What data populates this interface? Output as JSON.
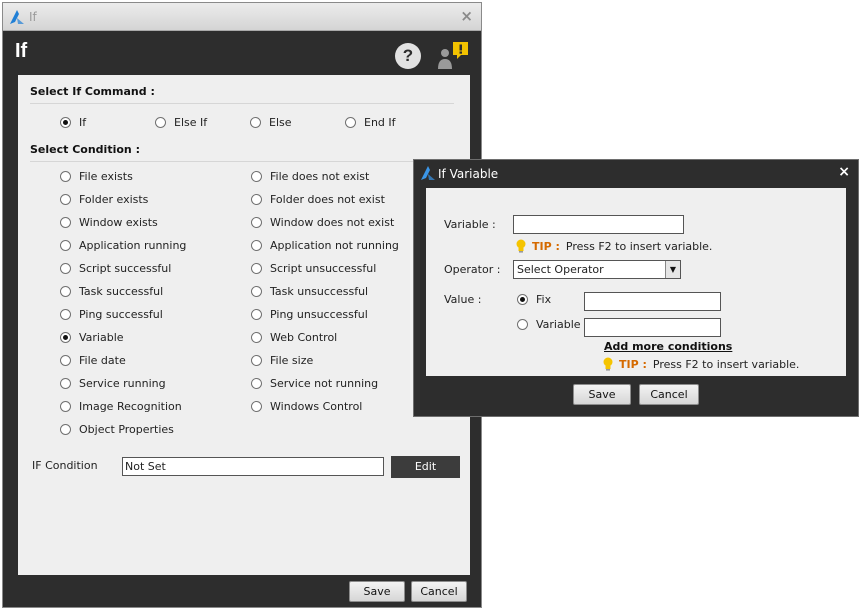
{
  "main_window": {
    "title": "If",
    "close_glyph": "×",
    "header_title": "If",
    "help_glyph": "?",
    "select_command_label": "Select If Command :",
    "commands": [
      {
        "label": "If",
        "checked": true
      },
      {
        "label": "Else If",
        "checked": false
      },
      {
        "label": "Else",
        "checked": false
      },
      {
        "label": "End If",
        "checked": false
      }
    ],
    "select_condition_label": "Select Condition :",
    "conditions_left": [
      {
        "label": "File exists",
        "checked": false
      },
      {
        "label": "Folder exists",
        "checked": false
      },
      {
        "label": "Window exists",
        "checked": false
      },
      {
        "label": "Application running",
        "checked": false
      },
      {
        "label": "Script successful",
        "checked": false
      },
      {
        "label": "Task successful",
        "checked": false
      },
      {
        "label": "Ping successful",
        "checked": false
      },
      {
        "label": "Variable",
        "checked": true
      },
      {
        "label": "File date",
        "checked": false
      },
      {
        "label": "Service running",
        "checked": false
      },
      {
        "label": "Image Recognition",
        "checked": false
      },
      {
        "label": "Object Properties",
        "checked": false
      }
    ],
    "conditions_right": [
      {
        "label": "File does not exist",
        "checked": false
      },
      {
        "label": "Folder does not exist",
        "checked": false
      },
      {
        "label": "Window does not exist",
        "checked": false
      },
      {
        "label": "Application not running",
        "checked": false
      },
      {
        "label": "Script unsuccessful",
        "checked": false
      },
      {
        "label": "Task unsuccessful",
        "checked": false
      },
      {
        "label": "Ping unsuccessful",
        "checked": false
      },
      {
        "label": "Web Control",
        "checked": false
      },
      {
        "label": "File size",
        "checked": false
      },
      {
        "label": "Service not running",
        "checked": false
      },
      {
        "label": "Windows Control",
        "checked": false
      }
    ],
    "if_condition_label": "IF Condition",
    "if_condition_value": "Not Set",
    "edit_label": "Edit",
    "save_label": "Save",
    "cancel_label": "Cancel"
  },
  "variable_dialog": {
    "title": "If Variable",
    "close_glyph": "×",
    "variable_label": "Variable :",
    "variable_value": "",
    "tip_label": "TIP :",
    "tip_text": "Press F2 to insert variable.",
    "operator_label": "Operator :",
    "operator_value": "Select Operator",
    "value_label": "Value :",
    "value_options": [
      {
        "label": "Fix",
        "checked": true,
        "value": ""
      },
      {
        "label": "Variable",
        "checked": false,
        "value": ""
      }
    ],
    "add_more_label": "Add more conditions",
    "tip2_label": "TIP :",
    "tip2_text": "Press F2 to insert variable.",
    "save_label": "Save",
    "cancel_label": "Cancel"
  },
  "colors": {
    "dark_frame": "#2d2d2d",
    "content_bg": "#efefef",
    "tip_accent": "#d56a00",
    "logo_blue": "#1f7fd6",
    "alert_yellow": "#f2c200"
  }
}
